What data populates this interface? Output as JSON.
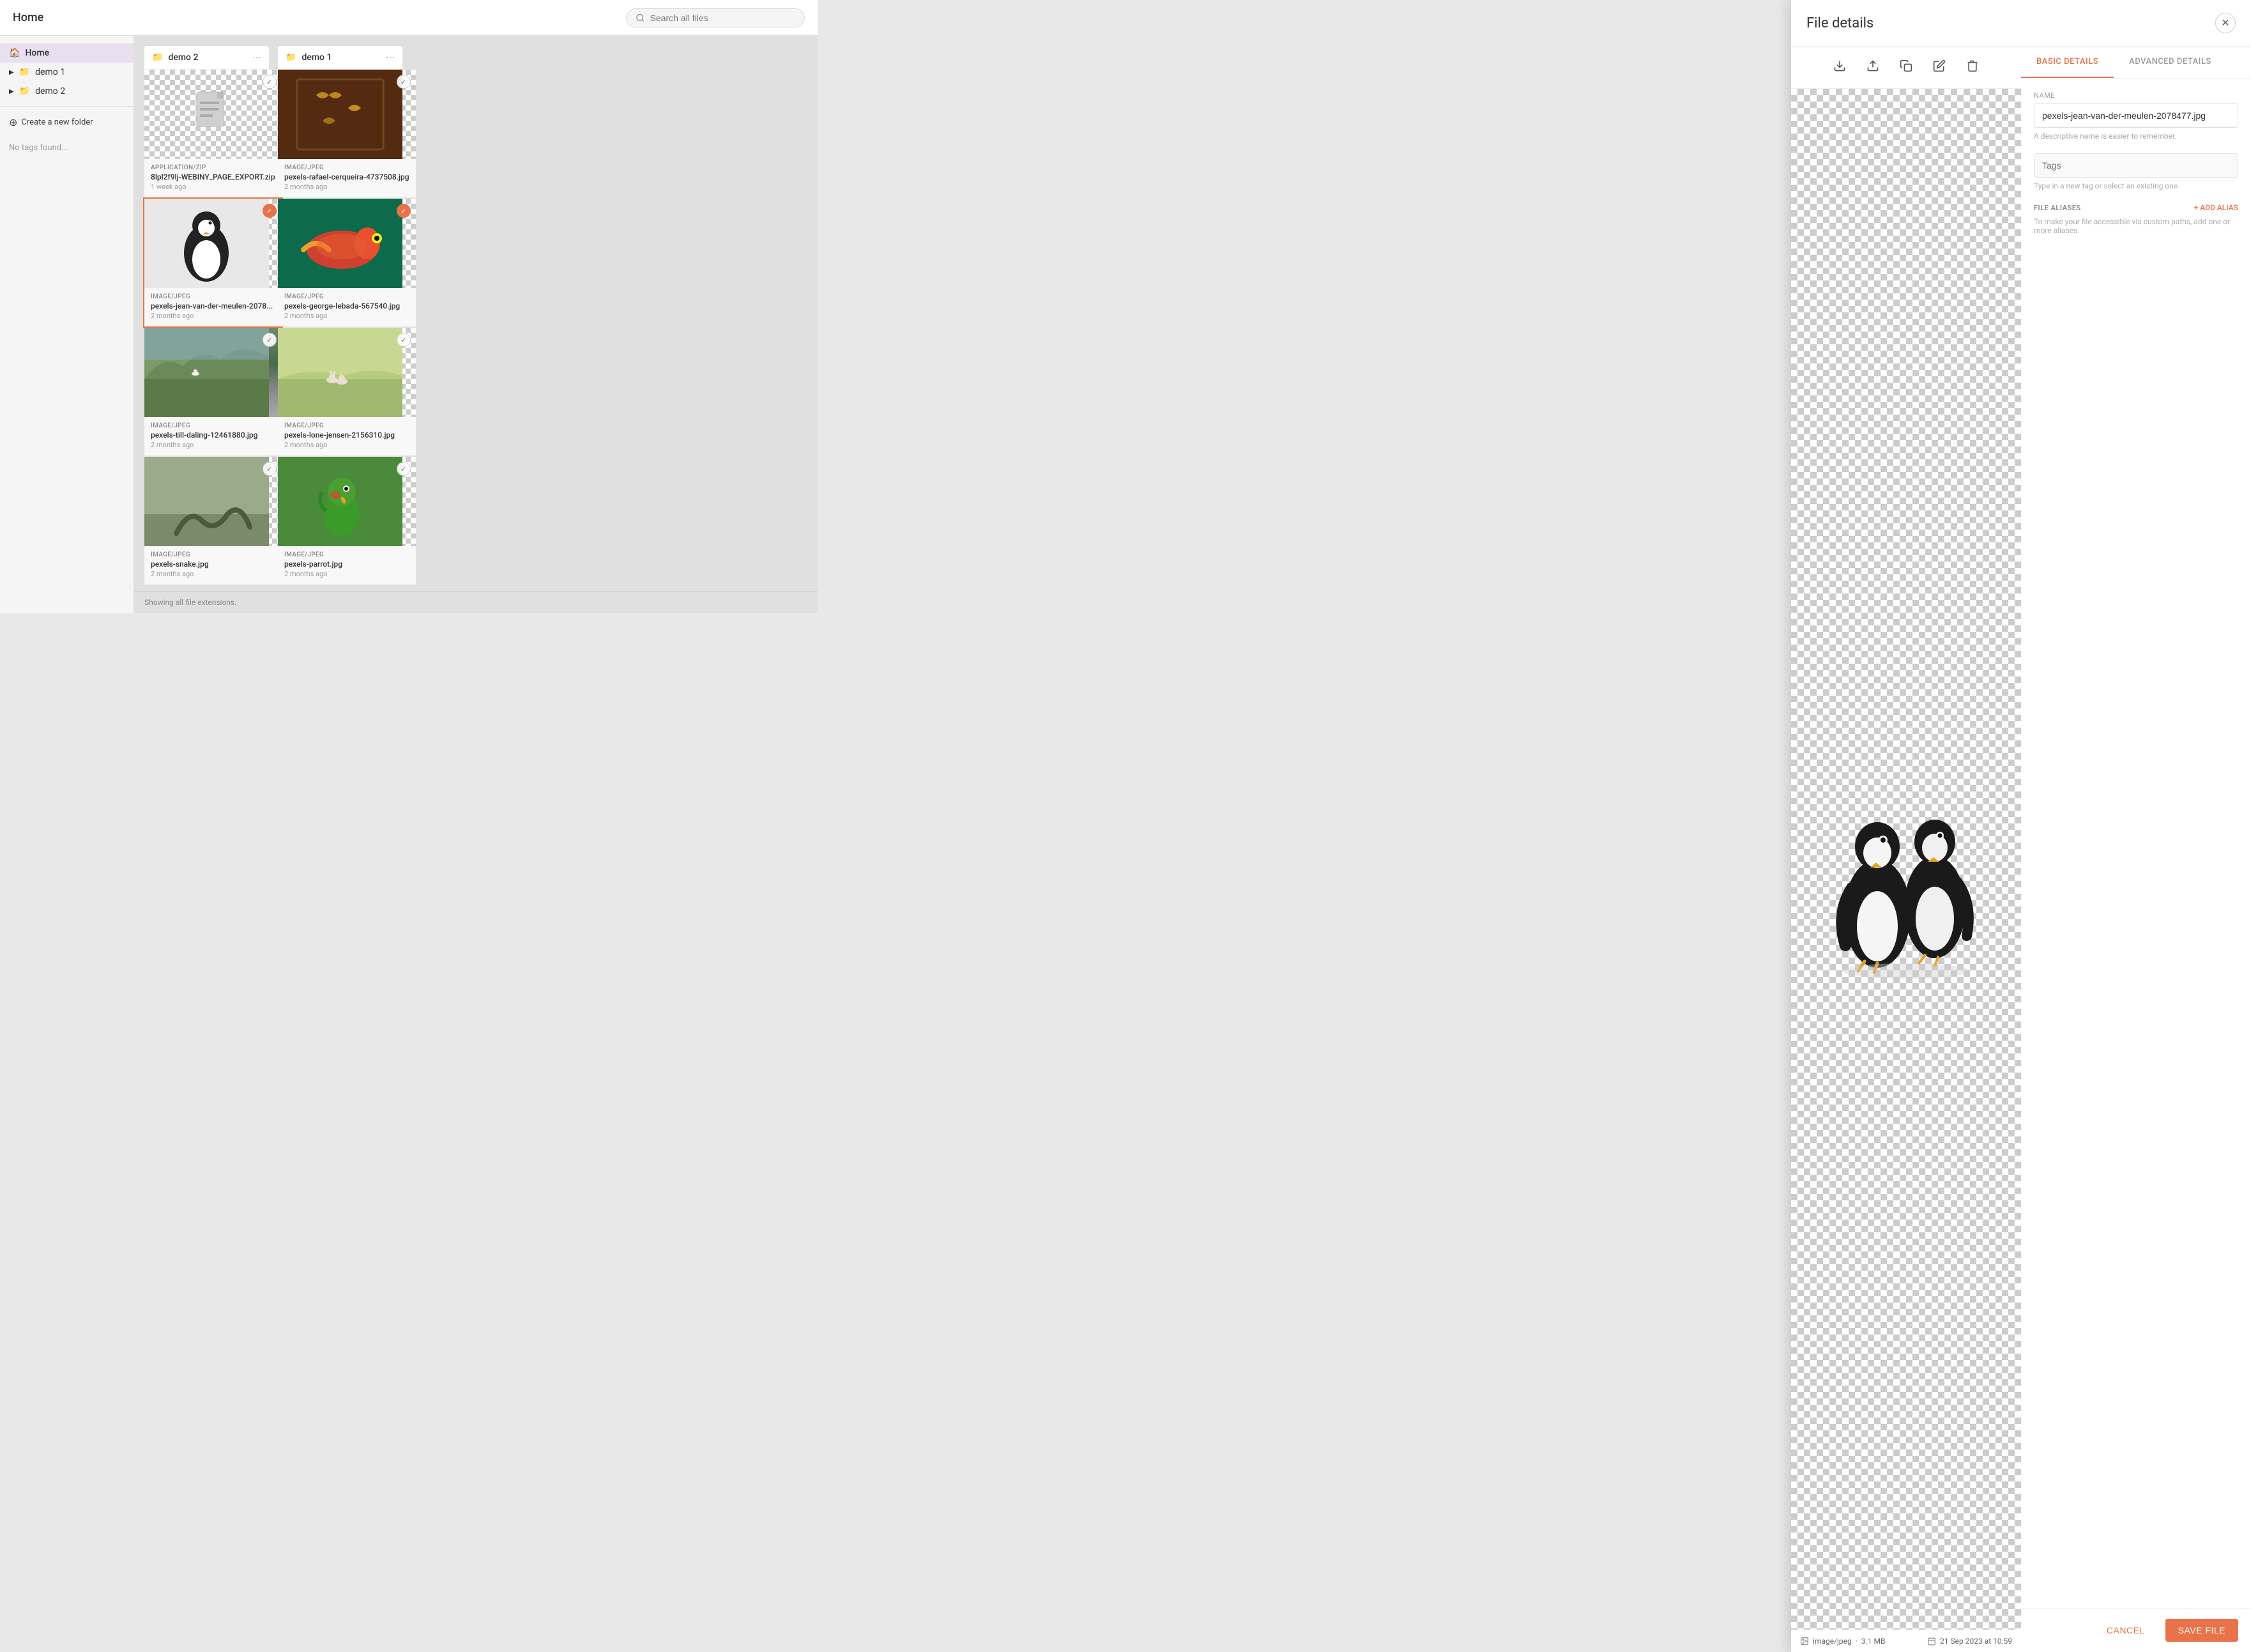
{
  "header": {
    "title": "Home",
    "search_placeholder": "Search all files"
  },
  "sidebar": {
    "home_label": "Home",
    "items": [
      {
        "id": "home",
        "label": "Home",
        "active": true
      },
      {
        "id": "demo1",
        "label": "demo 1"
      },
      {
        "id": "demo2",
        "label": "demo 2"
      }
    ],
    "create_folder_label": "Create a new folder",
    "no_tags_label": "No tags found..."
  },
  "columns": [
    {
      "id": "demo2",
      "label": "demo 2",
      "files": [
        {
          "type": "APPLICATION/ZIP",
          "name": "8lpl2f9lj-WEBINY_PAGE_EXPORT.zip",
          "date": "1 week ago",
          "thumb": "doc"
        },
        {
          "type": "IMAGE/JPEG",
          "name": "pexels-jean-van-der-meulen-2078...",
          "date": "2 months ago",
          "thumb": "penguin1",
          "checked": true
        },
        {
          "type": "IMAGE/JPEG",
          "name": "pexels-till-daling-12461880.jpg",
          "date": "2 months ago",
          "thumb": "highland"
        },
        {
          "type": "IMAGE/JPEG",
          "name": "pexels-snake.jpg",
          "date": "2 months ago",
          "thumb": "snake"
        }
      ]
    },
    {
      "id": "demo1",
      "label": "demo 1",
      "files": [
        {
          "type": "IMAGE/JPEG",
          "name": "pexels-rafael-cerqueira-4737508.jpg",
          "date": "2 months ago",
          "thumb": "butterflies"
        },
        {
          "type": "IMAGE/JPEG",
          "name": "pexels-george-lebada-567540.jpg",
          "date": "2 months ago",
          "thumb": "chameleon",
          "checked": true
        },
        {
          "type": "IMAGE/JPEG",
          "name": "pexels-lone-jensen-2156310.jpg",
          "date": "2 months ago",
          "thumb": "rabbits"
        },
        {
          "type": "IMAGE/JPEG",
          "name": "pexels-parrot.jpg",
          "date": "2 months ago",
          "thumb": "parrot"
        }
      ]
    }
  ],
  "footer": {
    "label": "Showing all file extensions."
  },
  "file_detail": {
    "title": "File details",
    "tabs": [
      {
        "id": "basic",
        "label": "BASIC DETAILS",
        "active": true
      },
      {
        "id": "advanced",
        "label": "ADVANCED DETAILS"
      }
    ],
    "fields": {
      "name_label": "Name",
      "name_value": "pexels-jean-van-der-meulen-2078477.jpg",
      "name_hint": "A descriptive name is easier to remember.",
      "tags_label": "Tags",
      "tags_placeholder": "Tags",
      "tags_hint": "Type in a new tag or select an existing one."
    },
    "aliases_section": {
      "title": "FILE ALIASES",
      "add_label": "+ ADD ALIAS",
      "hint": "To make your file accessible via custom paths, add one or more aliases."
    },
    "preview": {
      "file_type": "image/jpeg",
      "file_size": "3.1 MB",
      "date": "21 Sep 2023 at 10:59"
    },
    "actions": {
      "cancel_label": "CANCEL",
      "save_label": "SAVE FILE"
    }
  }
}
